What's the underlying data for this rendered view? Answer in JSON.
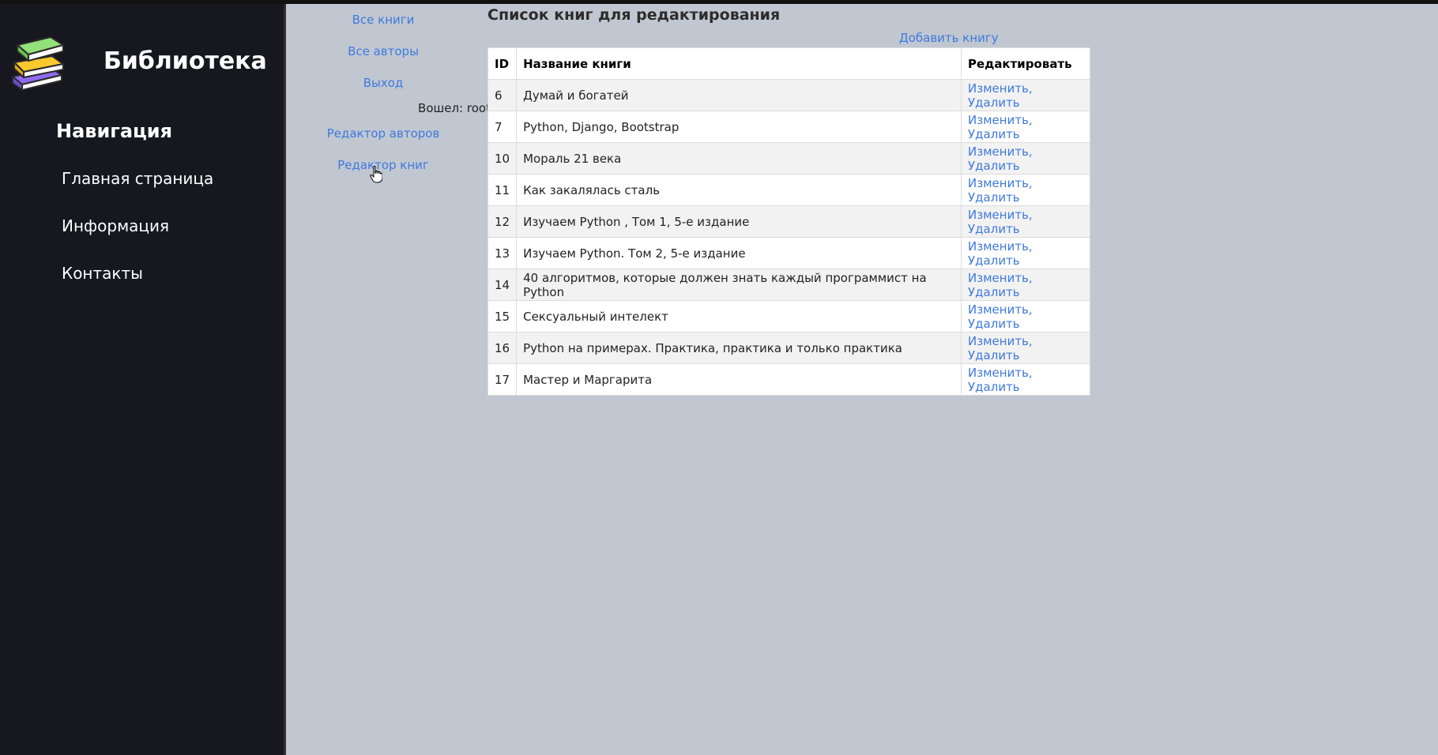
{
  "sidebar": {
    "brand": "Библиотека",
    "nav_title": "Навигация",
    "items": [
      {
        "label": "Главная страница"
      },
      {
        "label": "Информация"
      },
      {
        "label": "Контакты"
      }
    ]
  },
  "links": {
    "all_books": "Все книги",
    "all_authors": "Все авторы",
    "logout": "Выход",
    "logged_in": "Вошел: root",
    "authors_editor": "Редактор авторов",
    "books_editor": "Редактор книг"
  },
  "main": {
    "title": "Список книг для редактирования",
    "add_book": "Добавить книгу",
    "table": {
      "headers": [
        "ID",
        "Название книги",
        "Редактировать"
      ],
      "rows": [
        {
          "id": "6",
          "title": "Думай и богатей",
          "edit": "Изменить",
          "delete": "Удалить"
        },
        {
          "id": "7",
          "title": "Python, Django, Bootstrap",
          "edit": "Изменить",
          "delete": "Удалить"
        },
        {
          "id": "10",
          "title": "Мораль 21 века",
          "edit": "Изменить",
          "delete": "Удалить"
        },
        {
          "id": "11",
          "title": "Как закалялась сталь",
          "edit": "Изменить",
          "delete": "Удалить"
        },
        {
          "id": "12",
          "title": "Изучаем Python , Том 1, 5-е издание",
          "edit": "Изменить",
          "delete": "Удалить"
        },
        {
          "id": "13",
          "title": "Изучаем Python. Том 2, 5-е издание",
          "edit": "Изменить",
          "delete": "Удалить"
        },
        {
          "id": "14",
          "title": "40 алгоритмов, которые должен знать каждый программист на Python",
          "edit": "Изменить",
          "delete": "Удалить"
        },
        {
          "id": "15",
          "title": "Сексуальный интелект",
          "edit": "Изменить",
          "delete": "Удалить"
        },
        {
          "id": "16",
          "title": "Python на примерах. Практика, практика и только практика",
          "edit": "Изменить",
          "delete": "Удалить"
        },
        {
          "id": "17",
          "title": "Мастер и Маргарита",
          "edit": "Изменить",
          "delete": "Удалить"
        }
      ]
    }
  },
  "colors": {
    "sidebar_bg": "#16171f",
    "page_bg": "#c0c7d1",
    "link": "#3f79dc"
  },
  "icons": {
    "logo": "books-stack-icon",
    "cursor": "hand-pointer-icon"
  }
}
